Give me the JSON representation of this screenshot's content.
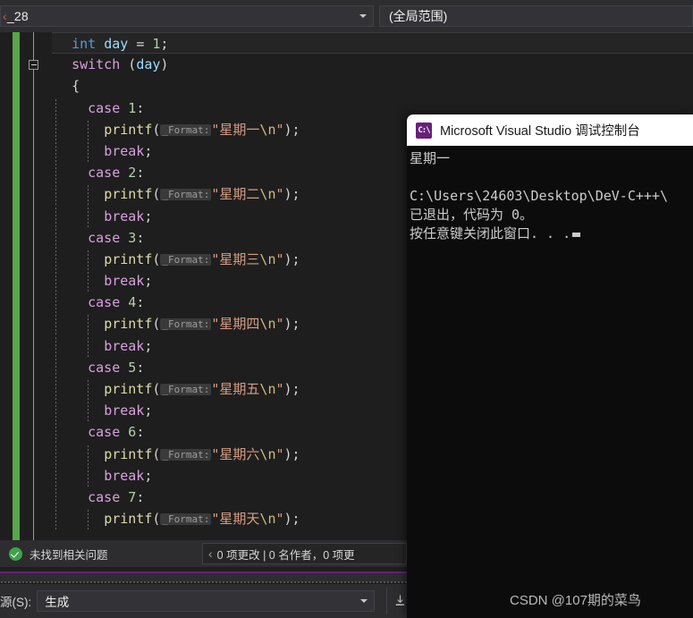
{
  "navbar": {
    "combo_prefix": "‹",
    "combo_value": "_28",
    "scope_value": "(全局范围)",
    "dropdown_icon": "chevron-down-icon"
  },
  "editor": {
    "lines": [
      {
        "indent": 2,
        "current": true,
        "tokens": [
          {
            "t": "int",
            "c": "k-type"
          },
          {
            "t": " ",
            "c": "k-punc"
          },
          {
            "t": "day",
            "c": "k-var"
          },
          {
            "t": " ",
            "c": "k-punc"
          },
          {
            "t": "=",
            "c": "k-punc"
          },
          {
            "t": " ",
            "c": "k-punc"
          },
          {
            "t": "1",
            "c": "k-num"
          },
          {
            "t": ";",
            "c": "k-punc"
          }
        ]
      },
      {
        "indent": 2,
        "tokens": [
          {
            "t": "switch",
            "c": "k-ctrl"
          },
          {
            "t": " (",
            "c": "k-punc"
          },
          {
            "t": "day",
            "c": "k-var"
          },
          {
            "t": ")",
            "c": "k-punc"
          }
        ]
      },
      {
        "indent": 2,
        "tokens": [
          {
            "t": "{",
            "c": "k-punc"
          }
        ]
      },
      {
        "indent": 4,
        "tokens": [
          {
            "t": "case",
            "c": "k-ctrl"
          },
          {
            "t": " ",
            "c": "k-punc"
          },
          {
            "t": "1",
            "c": "k-num"
          },
          {
            "t": ":",
            "c": "k-punc"
          }
        ]
      },
      {
        "indent": 6,
        "tokens": [
          {
            "t": "printf",
            "c": "k-fn"
          },
          {
            "t": "(",
            "c": "k-punc"
          },
          {
            "t": "_Format:",
            "c": "hint"
          },
          {
            "t": "\"星期一",
            "c": "k-str"
          },
          {
            "t": "\\n",
            "c": "k-esc"
          },
          {
            "t": "\"",
            "c": "k-str"
          },
          {
            "t": ");",
            "c": "k-punc"
          }
        ]
      },
      {
        "indent": 6,
        "tokens": [
          {
            "t": "break",
            "c": "k-ctrl"
          },
          {
            "t": ";",
            "c": "k-punc"
          }
        ]
      },
      {
        "indent": 4,
        "tokens": [
          {
            "t": "case",
            "c": "k-ctrl"
          },
          {
            "t": " ",
            "c": "k-punc"
          },
          {
            "t": "2",
            "c": "k-num"
          },
          {
            "t": ":",
            "c": "k-punc"
          }
        ]
      },
      {
        "indent": 6,
        "tokens": [
          {
            "t": "printf",
            "c": "k-fn"
          },
          {
            "t": "(",
            "c": "k-punc"
          },
          {
            "t": "_Format:",
            "c": "hint"
          },
          {
            "t": "\"星期二",
            "c": "k-str"
          },
          {
            "t": "\\n",
            "c": "k-esc"
          },
          {
            "t": "\"",
            "c": "k-str"
          },
          {
            "t": ");",
            "c": "k-punc"
          }
        ]
      },
      {
        "indent": 6,
        "tokens": [
          {
            "t": "break",
            "c": "k-ctrl"
          },
          {
            "t": ";",
            "c": "k-punc"
          }
        ]
      },
      {
        "indent": 4,
        "tokens": [
          {
            "t": "case",
            "c": "k-ctrl"
          },
          {
            "t": " ",
            "c": "k-punc"
          },
          {
            "t": "3",
            "c": "k-num"
          },
          {
            "t": ":",
            "c": "k-punc"
          }
        ]
      },
      {
        "indent": 6,
        "tokens": [
          {
            "t": "printf",
            "c": "k-fn"
          },
          {
            "t": "(",
            "c": "k-punc"
          },
          {
            "t": "_Format:",
            "c": "hint"
          },
          {
            "t": "\"星期三",
            "c": "k-str"
          },
          {
            "t": "\\n",
            "c": "k-esc"
          },
          {
            "t": "\"",
            "c": "k-str"
          },
          {
            "t": ");",
            "c": "k-punc"
          }
        ]
      },
      {
        "indent": 6,
        "tokens": [
          {
            "t": "break",
            "c": "k-ctrl"
          },
          {
            "t": ";",
            "c": "k-punc"
          }
        ]
      },
      {
        "indent": 4,
        "tokens": [
          {
            "t": "case",
            "c": "k-ctrl"
          },
          {
            "t": " ",
            "c": "k-punc"
          },
          {
            "t": "4",
            "c": "k-num"
          },
          {
            "t": ":",
            "c": "k-punc"
          }
        ]
      },
      {
        "indent": 6,
        "tokens": [
          {
            "t": "printf",
            "c": "k-fn"
          },
          {
            "t": "(",
            "c": "k-punc"
          },
          {
            "t": "_Format:",
            "c": "hint"
          },
          {
            "t": "\"星期四",
            "c": "k-str"
          },
          {
            "t": "\\n",
            "c": "k-esc"
          },
          {
            "t": "\"",
            "c": "k-str"
          },
          {
            "t": ");",
            "c": "k-punc"
          }
        ]
      },
      {
        "indent": 6,
        "tokens": [
          {
            "t": "break",
            "c": "k-ctrl"
          },
          {
            "t": ";",
            "c": "k-punc"
          }
        ]
      },
      {
        "indent": 4,
        "tokens": [
          {
            "t": "case",
            "c": "k-ctrl"
          },
          {
            "t": " ",
            "c": "k-punc"
          },
          {
            "t": "5",
            "c": "k-num"
          },
          {
            "t": ":",
            "c": "k-punc"
          }
        ]
      },
      {
        "indent": 6,
        "tokens": [
          {
            "t": "printf",
            "c": "k-fn"
          },
          {
            "t": "(",
            "c": "k-punc"
          },
          {
            "t": "_Format:",
            "c": "hint"
          },
          {
            "t": "\"星期五",
            "c": "k-str"
          },
          {
            "t": "\\n",
            "c": "k-esc"
          },
          {
            "t": "\"",
            "c": "k-str"
          },
          {
            "t": ");",
            "c": "k-punc"
          }
        ]
      },
      {
        "indent": 6,
        "tokens": [
          {
            "t": "break",
            "c": "k-ctrl"
          },
          {
            "t": ";",
            "c": "k-punc"
          }
        ]
      },
      {
        "indent": 4,
        "tokens": [
          {
            "t": "case",
            "c": "k-ctrl"
          },
          {
            "t": " ",
            "c": "k-punc"
          },
          {
            "t": "6",
            "c": "k-num"
          },
          {
            "t": ":",
            "c": "k-punc"
          }
        ]
      },
      {
        "indent": 6,
        "tokens": [
          {
            "t": "printf",
            "c": "k-fn"
          },
          {
            "t": "(",
            "c": "k-punc"
          },
          {
            "t": "_Format:",
            "c": "hint"
          },
          {
            "t": "\"星期六",
            "c": "k-str"
          },
          {
            "t": "\\n",
            "c": "k-esc"
          },
          {
            "t": "\"",
            "c": "k-str"
          },
          {
            "t": ");",
            "c": "k-punc"
          }
        ]
      },
      {
        "indent": 6,
        "tokens": [
          {
            "t": "break",
            "c": "k-ctrl"
          },
          {
            "t": ";",
            "c": "k-punc"
          }
        ]
      },
      {
        "indent": 4,
        "tokens": [
          {
            "t": "case",
            "c": "k-ctrl"
          },
          {
            "t": " ",
            "c": "k-punc"
          },
          {
            "t": "7",
            "c": "k-num"
          },
          {
            "t": ":",
            "c": "k-punc"
          }
        ]
      },
      {
        "indent": 6,
        "tokens": [
          {
            "t": "printf",
            "c": "k-fn"
          },
          {
            "t": "(",
            "c": "k-punc"
          },
          {
            "t": "_Format:",
            "c": "hint"
          },
          {
            "t": "\"星期天",
            "c": "k-str"
          },
          {
            "t": "\\n",
            "c": "k-esc"
          },
          {
            "t": "\"",
            "c": "k-str"
          },
          {
            "t": ");",
            "c": "k-punc"
          }
        ]
      }
    ]
  },
  "console": {
    "icon": "visual-studio-console-icon",
    "icon_glyph": "C:\\",
    "title": "Microsoft Visual Studio 调试控制台",
    "output_lines": [
      "星期一",
      "",
      "C:\\Users\\24603\\Desktop\\DeV-C+++\\",
      "已退出，代码为 0。",
      "按任意键关闭此窗口. . ."
    ]
  },
  "statusbar": {
    "status_icon": "check-circle-icon",
    "status_text": "未找到相关问题",
    "history_chevron": "‹",
    "history_text": "0 项更改 | 0 名作者，0 项更"
  },
  "bottom_panel": {
    "source_label": "源(S):",
    "source_value": "生成",
    "dropdown_icon": "chevron-down-icon",
    "action_icon": "save-to-file-icon"
  },
  "watermark": {
    "text": "CSDN @107期的菜鸟"
  },
  "colors": {
    "editor_background": "#1e1e1e",
    "chrome_background": "#2d2d30",
    "change_bar_green": "#57a64a",
    "accent_purple": "#68217a",
    "console_background": "#0c0c0c",
    "status_ok_green": "#3ea34a"
  }
}
